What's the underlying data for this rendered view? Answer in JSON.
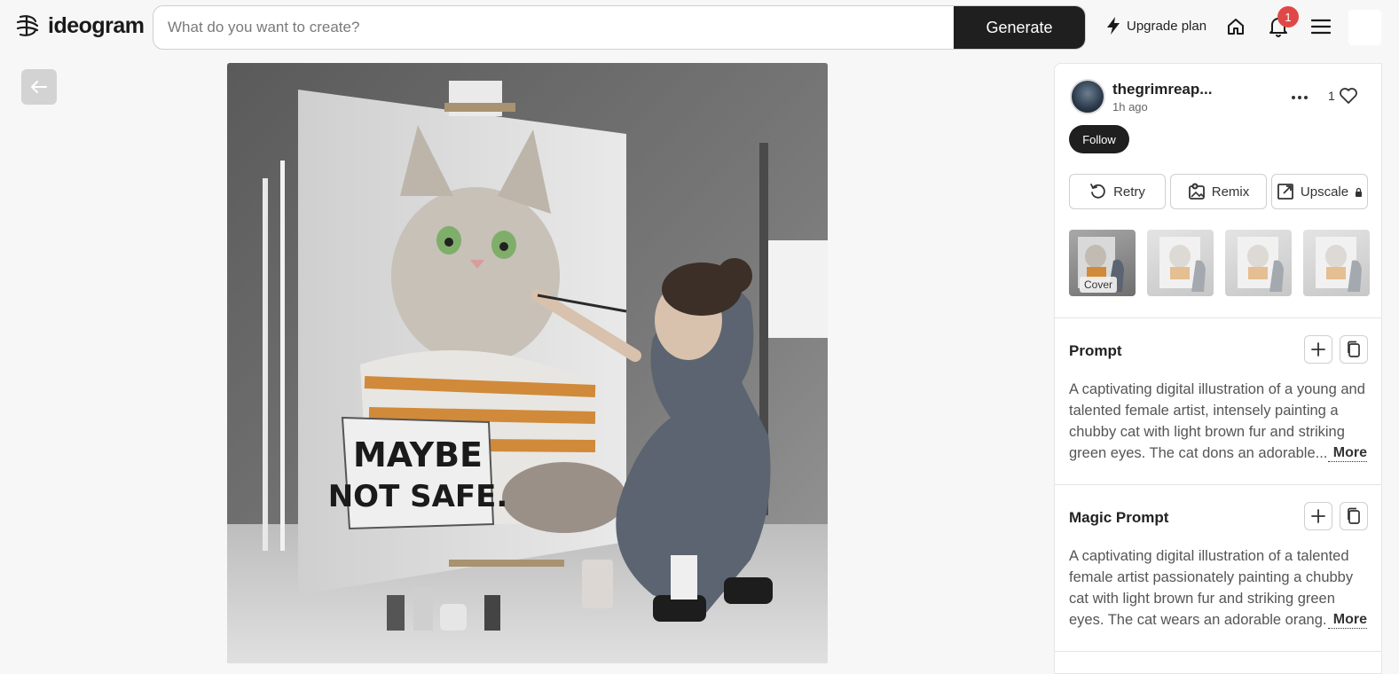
{
  "brand": {
    "name": "ideogram"
  },
  "search": {
    "placeholder": "What do you want to create?",
    "generate_label": "Generate"
  },
  "nav": {
    "upgrade_label": "Upgrade plan",
    "notification_count": "1"
  },
  "image": {
    "sign_text_line1": "MAYBE",
    "sign_text_line2": "NOT SAFE."
  },
  "post": {
    "username": "thegrimreap...",
    "time": "1h ago",
    "like_count": "1",
    "follow_label": "Follow",
    "actions": {
      "retry": "Retry",
      "remix": "Remix",
      "upscale": "Upscale"
    },
    "cover_label": "Cover"
  },
  "prompt": {
    "title": "Prompt",
    "text": "A captivating digital illustration of a young and talented female artist, intensely painting a chubby cat with light brown fur and striking green eyes. The cat dons an adorable...",
    "more": "More"
  },
  "magic_prompt": {
    "title": "Magic Prompt",
    "text": "A captivating digital illustration of a talented female artist passionately painting a chubby cat with light brown fur and striking green eyes. The cat wears an adorable orang...",
    "more": "More"
  },
  "colors": {
    "accent_dark": "#1f1f1f",
    "badge": "#e04848"
  }
}
